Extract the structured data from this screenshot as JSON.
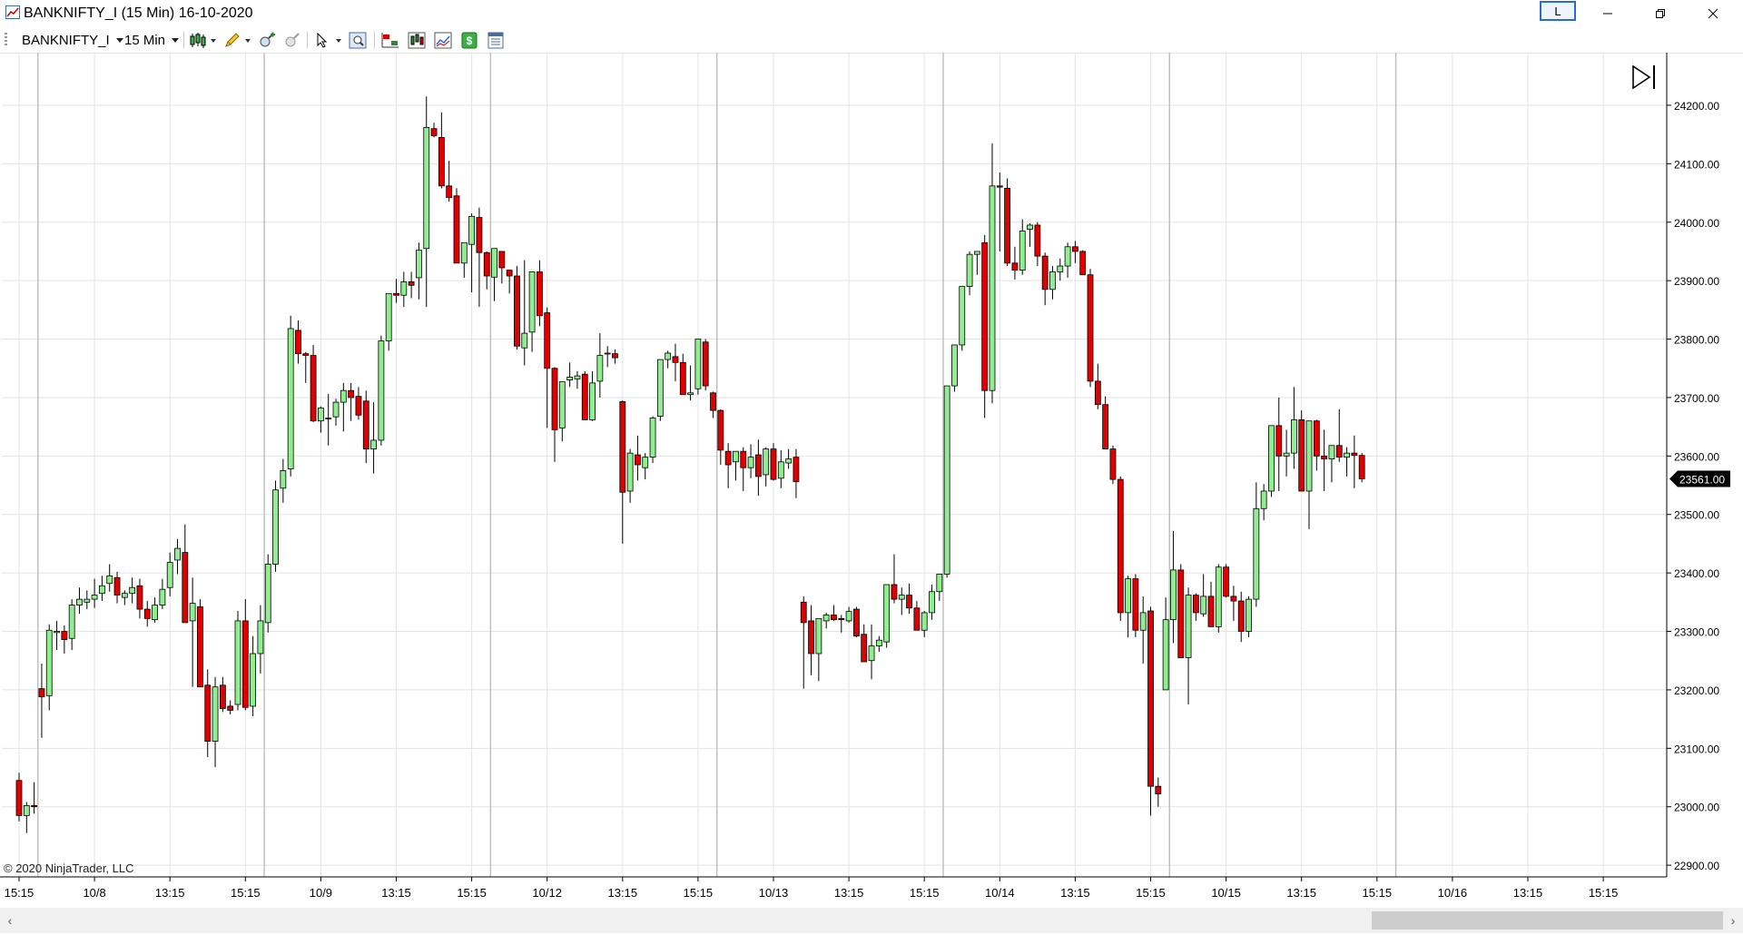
{
  "window": {
    "title": "BANKNIFTY_I (15 Min)  16-10-2020",
    "layout_badge": "L"
  },
  "toolbar": {
    "instrument": "BANKNIFTY_I",
    "interval": "15 Min"
  },
  "chart_data": {
    "type": "candlestick",
    "copyright": "© 2020 NinjaTrader, LLC",
    "last_price_label": "23561.00",
    "colors": {
      "up": "#90ee90",
      "down": "#e00000",
      "outline": "#000000",
      "grid": "#e3e3e3"
    },
    "ylim": [
      22880,
      24290
    ],
    "y_ticks": [
      "22900.00",
      "23000.00",
      "23100.00",
      "23200.00",
      "23300.00",
      "23400.00",
      "23500.00",
      "23600.00",
      "23700.00",
      "23800.00",
      "23900.00",
      "24000.00",
      "24100.00",
      "24200.00"
    ],
    "y_tick_values": [
      22900,
      23000,
      23100,
      23200,
      23300,
      23400,
      23500,
      23600,
      23700,
      23800,
      23900,
      24000,
      24100,
      24200
    ],
    "x_ticks": [
      {
        "i": 0,
        "label": "15:15"
      },
      {
        "i": 10,
        "label": "10/8"
      },
      {
        "i": 20,
        "label": "13:15"
      },
      {
        "i": 30,
        "label": "15:15"
      },
      {
        "i": 40,
        "label": "10/9"
      },
      {
        "i": 50,
        "label": "13:15"
      },
      {
        "i": 60,
        "label": "15:15"
      },
      {
        "i": 70,
        "label": "10/12"
      },
      {
        "i": 80,
        "label": "13:15"
      },
      {
        "i": 90,
        "label": "15:15"
      },
      {
        "i": 100,
        "label": "10/13"
      },
      {
        "i": 110,
        "label": "13:15"
      },
      {
        "i": 120,
        "label": "15:15"
      },
      {
        "i": 130,
        "label": "10/14"
      },
      {
        "i": 140,
        "label": "13:15"
      },
      {
        "i": 150,
        "label": "15:15"
      },
      {
        "i": 160,
        "label": "10/15"
      },
      {
        "i": 170,
        "label": "13:15"
      },
      {
        "i": 180,
        "label": "15:15"
      },
      {
        "i": 190,
        "label": "10/16"
      },
      {
        "i": 200,
        "label": "13:15"
      },
      {
        "i": 210,
        "label": "15:15"
      }
    ],
    "session_breaks": [
      2,
      32,
      62,
      92,
      122,
      152,
      182
    ],
    "candles": [
      [
        23045,
        23058,
        22975,
        22985
      ],
      [
        22985,
        23008,
        22955,
        23002
      ],
      [
        23002,
        23042,
        22988,
        23000
      ],
      [
        23202,
        23245,
        23118,
        23188
      ],
      [
        23190,
        23312,
        23165,
        23302
      ],
      [
        23298,
        23318,
        23268,
        23300
      ],
      [
        23300,
        23310,
        23262,
        23286
      ],
      [
        23288,
        23355,
        23268,
        23345
      ],
      [
        23345,
        23375,
        23330,
        23355
      ],
      [
        23350,
        23370,
        23338,
        23355
      ],
      [
        23355,
        23390,
        23340,
        23362
      ],
      [
        23365,
        23395,
        23352,
        23378
      ],
      [
        23382,
        23415,
        23368,
        23395
      ],
      [
        23392,
        23402,
        23348,
        23362
      ],
      [
        23358,
        23370,
        23345,
        23365
      ],
      [
        23365,
        23392,
        23348,
        23375
      ],
      [
        23378,
        23390,
        23322,
        23338
      ],
      [
        23338,
        23352,
        23308,
        23322
      ],
      [
        23320,
        23358,
        23315,
        23345
      ],
      [
        23345,
        23390,
        23338,
        23372
      ],
      [
        23375,
        23435,
        23360,
        23418
      ],
      [
        23422,
        23458,
        23398,
        23442
      ],
      [
        23435,
        23483,
        23410,
        23315
      ],
      [
        23318,
        23392,
        23205,
        23348
      ],
      [
        23342,
        23355,
        23210,
        23205
      ],
      [
        23208,
        23235,
        23085,
        23112
      ],
      [
        23112,
        23222,
        23068,
        23205
      ],
      [
        23208,
        23222,
        23162,
        23168
      ],
      [
        23172,
        23182,
        23158,
        23165
      ],
      [
        23175,
        23335,
        23165,
        23318
      ],
      [
        23318,
        23355,
        23165,
        23170
      ],
      [
        23172,
        23292,
        23155,
        23262
      ],
      [
        23262,
        23345,
        23228,
        23318
      ],
      [
        23315,
        23432,
        23298,
        23415
      ],
      [
        23415,
        23558,
        23402,
        23542
      ],
      [
        23545,
        23595,
        23520,
        23575
      ],
      [
        23578,
        23840,
        23565,
        23818
      ],
      [
        23815,
        23832,
        23758,
        23775
      ],
      [
        23775,
        23778,
        23725,
        23772
      ],
      [
        23772,
        23790,
        23658,
        23660
      ],
      [
        23660,
        23685,
        23640,
        23682
      ],
      [
        23665,
        23706,
        23618,
        23665
      ],
      [
        23667,
        23698,
        23652,
        23692
      ],
      [
        23692,
        23725,
        23642,
        23712
      ],
      [
        23712,
        23725,
        23660,
        23700
      ],
      [
        23702,
        23718,
        23662,
        23670
      ],
      [
        23694,
        23712,
        23588,
        23612
      ],
      [
        23612,
        23692,
        23570,
        23627
      ],
      [
        23627,
        23806,
        23618,
        23797
      ],
      [
        23797,
        23875,
        23780,
        23878
      ],
      [
        23878,
        23903,
        23862,
        23875
      ],
      [
        23875,
        23915,
        23855,
        23898
      ],
      [
        23898,
        23915,
        23870,
        23892
      ],
      [
        23905,
        23965,
        23868,
        23952
      ],
      [
        23955,
        24215,
        23855,
        24162
      ],
      [
        24160,
        24170,
        24145,
        24148
      ],
      [
        24145,
        24188,
        24058,
        24062
      ],
      [
        24062,
        24105,
        24035,
        24042
      ],
      [
        24045,
        24058,
        23935,
        23930
      ],
      [
        23930,
        23965,
        23905,
        23965
      ],
      [
        23962,
        24015,
        23880,
        24010
      ],
      [
        24008,
        24025,
        23855,
        23948
      ],
      [
        23948,
        23950,
        23885,
        23908
      ],
      [
        23906,
        23952,
        23865,
        23955
      ],
      [
        23950,
        23948,
        23895,
        23922
      ],
      [
        23918,
        23918,
        23878,
        23908
      ],
      [
        23908,
        23925,
        23782,
        23788
      ],
      [
        23785,
        23935,
        23755,
        23810
      ],
      [
        23812,
        23900,
        23778,
        23915
      ],
      [
        23915,
        23935,
        23822,
        23840
      ],
      [
        23845,
        23854,
        23648,
        23750
      ],
      [
        23750,
        23752,
        23590,
        23645
      ],
      [
        23648,
        23672,
        23625,
        23727
      ],
      [
        23730,
        23760,
        23718,
        23735
      ],
      [
        23732,
        23745,
        23715,
        23737
      ],
      [
        23740,
        23745,
        23665,
        23662
      ],
      [
        23662,
        23745,
        23660,
        23725
      ],
      [
        23728,
        23810,
        23700,
        23772
      ],
      [
        23775,
        23788,
        23752,
        23776
      ],
      [
        23775,
        23782,
        23758,
        23768
      ],
      [
        23693,
        23695,
        23450,
        23538
      ],
      [
        23540,
        23612,
        23520,
        23605
      ],
      [
        23602,
        23635,
        23558,
        23585
      ],
      [
        23580,
        23605,
        23560,
        23598
      ],
      [
        23598,
        23668,
        23588,
        23665
      ],
      [
        23668,
        23755,
        23660,
        23765
      ],
      [
        23765,
        23780,
        23750,
        23776
      ],
      [
        23770,
        23792,
        23728,
        23760
      ],
      [
        23760,
        23775,
        23705,
        23705
      ],
      [
        23705,
        23755,
        23695,
        23708
      ],
      [
        23715,
        23800,
        23705,
        23800
      ],
      [
        23795,
        23800,
        23712,
        23720
      ],
      [
        23708,
        23710,
        23665,
        23678
      ],
      [
        23678,
        23680,
        23585,
        23610
      ],
      [
        23608,
        23622,
        23545,
        23585
      ],
      [
        23590,
        23608,
        23558,
        23608
      ],
      [
        23608,
        23615,
        23540,
        23580
      ],
      [
        23580,
        23620,
        23562,
        23598
      ],
      [
        23602,
        23628,
        23532,
        23565
      ],
      [
        23568,
        23615,
        23548,
        23612
      ],
      [
        23612,
        23622,
        23558,
        23560
      ],
      [
        23562,
        23610,
        23545,
        23590
      ],
      [
        23588,
        23612,
        23578,
        23595
      ],
      [
        23598,
        23612,
        23528,
        23556
      ],
      [
        23350,
        23360,
        23202,
        23315
      ],
      [
        23318,
        23345,
        23225,
        23262
      ],
      [
        23262,
        23320,
        23215,
        23322
      ],
      [
        23318,
        23332,
        23305,
        23328
      ],
      [
        23328,
        23345,
        23318,
        23320
      ],
      [
        23322,
        23328,
        23298,
        23320
      ],
      [
        23318,
        23342,
        23315,
        23334
      ],
      [
        23338,
        23342,
        23290,
        23292
      ],
      [
        23295,
        23312,
        23258,
        23248
      ],
      [
        23250,
        23312,
        23218,
        23275
      ],
      [
        23275,
        23292,
        23265,
        23285
      ],
      [
        23282,
        23352,
        23272,
        23380
      ],
      [
        23380,
        23432,
        23348,
        23355
      ],
      [
        23355,
        23375,
        23328,
        23362
      ],
      [
        23362,
        23382,
        23330,
        23340
      ],
      [
        23340,
        23352,
        23310,
        23302
      ],
      [
        23302,
        23335,
        23290,
        23332
      ],
      [
        23332,
        23380,
        23320,
        23368
      ],
      [
        23368,
        23398,
        23352,
        23398
      ],
      [
        23398,
        23650,
        23392,
        23720
      ],
      [
        23720,
        23780,
        23710,
        23790
      ],
      [
        23790,
        23890,
        23780,
        23890
      ],
      [
        23890,
        23950,
        23875,
        23945
      ],
      [
        23945,
        23950,
        23910,
        23950
      ],
      [
        23965,
        23978,
        23665,
        23712
      ],
      [
        23712,
        24135,
        23690,
        24062
      ],
      [
        24062,
        24085,
        23950,
        24060
      ],
      [
        24058,
        24075,
        23925,
        23930
      ],
      [
        23930,
        23958,
        23902,
        23918
      ],
      [
        23918,
        24005,
        23910,
        23985
      ],
      [
        23988,
        23998,
        23958,
        23995
      ],
      [
        23995,
        24000,
        23925,
        23942
      ],
      [
        23942,
        23948,
        23858,
        23885
      ],
      [
        23885,
        23925,
        23868,
        23915
      ],
      [
        23915,
        23938,
        23900,
        23925
      ],
      [
        23925,
        23965,
        23905,
        23958
      ],
      [
        23958,
        23968,
        23930,
        23950
      ],
      [
        23950,
        23952,
        23928,
        23910
      ],
      [
        23910,
        23920,
        23718,
        23728
      ],
      [
        23728,
        23758,
        23680,
        23688
      ],
      [
        23688,
        23702,
        23612,
        23612
      ],
      [
        23612,
        23618,
        23552,
        23560
      ],
      [
        23560,
        23565,
        23318,
        23332
      ],
      [
        23332,
        23395,
        23290,
        23390
      ],
      [
        23390,
        23398,
        23290,
        23302
      ],
      [
        23302,
        23360,
        23245,
        23332
      ],
      [
        23335,
        23342,
        22985,
        23035
      ],
      [
        23035,
        23050,
        23000,
        23022
      ],
      [
        23200,
        23358,
        23200,
        23320
      ],
      [
        23320,
        23472,
        23280,
        23405
      ],
      [
        23405,
        23415,
        23255,
        23255
      ],
      [
        23255,
        23375,
        23175,
        23362
      ],
      [
        23362,
        23365,
        23318,
        23332
      ],
      [
        23330,
        23398,
        23325,
        23360
      ],
      [
        23360,
        23385,
        23308,
        23308
      ],
      [
        23308,
        23415,
        23298,
        23410
      ],
      [
        23410,
        23415,
        23358,
        23360
      ],
      [
        23360,
        23378,
        23318,
        23352
      ],
      [
        23352,
        23368,
        23282,
        23300
      ],
      [
        23300,
        23360,
        23290,
        23355
      ],
      [
        23355,
        23555,
        23342,
        23510
      ],
      [
        23510,
        23552,
        23490,
        23540
      ],
      [
        23540,
        23600,
        23530,
        23652
      ],
      [
        23652,
        23700,
        23540,
        23600
      ],
      [
        23600,
        23645,
        23565,
        23605
      ],
      [
        23605,
        23718,
        23578,
        23662
      ],
      [
        23662,
        23678,
        23540,
        23540
      ],
      [
        23540,
        23645,
        23475,
        23660
      ],
      [
        23660,
        23662,
        23575,
        23600
      ],
      [
        23600,
        23645,
        23540,
        23595
      ],
      [
        23595,
        23612,
        23555,
        23618
      ],
      [
        23618,
        23680,
        23590,
        23598
      ],
      [
        23598,
        23615,
        23565,
        23605
      ],
      [
        23605,
        23635,
        23545,
        23601
      ],
      [
        23601,
        23605,
        23555,
        23561
      ]
    ]
  }
}
